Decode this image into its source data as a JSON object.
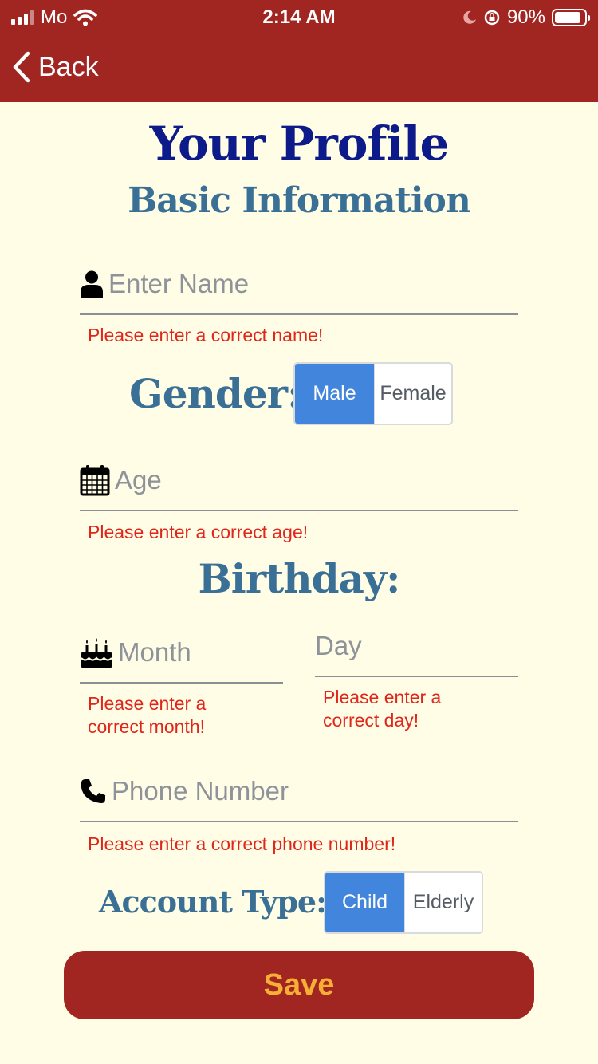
{
  "status_bar": {
    "carrier": "Mo",
    "time": "2:14 AM",
    "battery": "90%"
  },
  "nav": {
    "back_label": "Back"
  },
  "page_title": "Your Profile",
  "section_title": "Basic Information",
  "name_field": {
    "placeholder": "Enter Name",
    "icon": "person-icon",
    "error": "Please enter a correct name!"
  },
  "gender": {
    "label": "Gender:",
    "options": [
      "Male",
      "Female"
    ],
    "selected": "Male"
  },
  "age_field": {
    "placeholder": "Age",
    "icon": "calendar-icon",
    "error": "Please enter a correct age!"
  },
  "birthday": {
    "label": "Birthday:",
    "month": {
      "placeholder": "Month",
      "icon": "birthday-cake-icon",
      "error": "Please enter a correct month!"
    },
    "day": {
      "placeholder": "Day",
      "error": "Please enter a correct day!"
    }
  },
  "phone_field": {
    "placeholder": "Phone Number",
    "icon": "phone-icon",
    "error": "Please enter a correct phone number!"
  },
  "account_type": {
    "label": "Account Type:",
    "options": [
      "Child",
      "Elderly"
    ],
    "selected": "Child"
  },
  "save_label": "Save",
  "colors": {
    "header": "#a12621",
    "background": "#fffde6",
    "error": "#e0261b",
    "selected": "#4285dc",
    "save_text": "#f7ae35"
  }
}
